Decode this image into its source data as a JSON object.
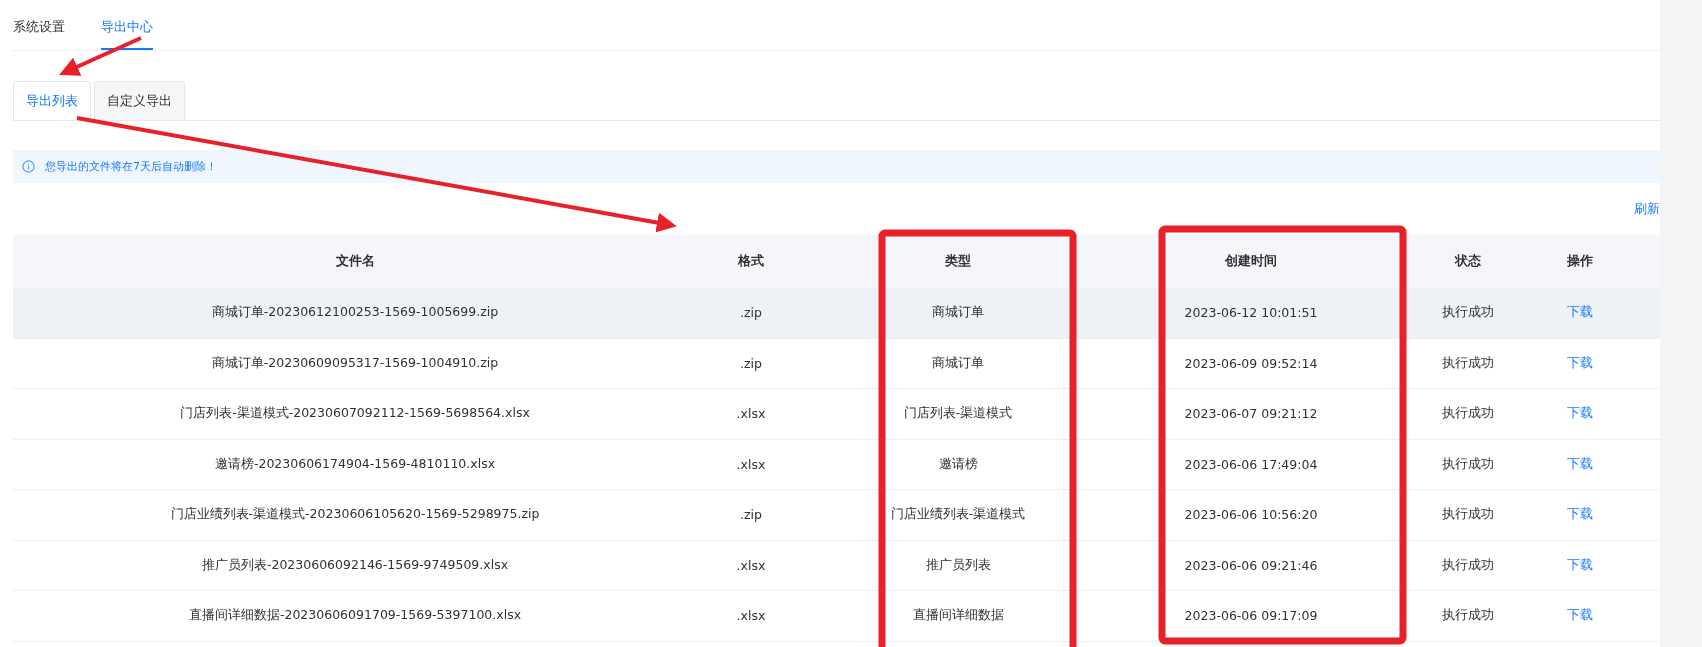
{
  "top_tabs": [
    {
      "label": "系统设置",
      "selected": false
    },
    {
      "label": "导出中心",
      "selected": true
    }
  ],
  "sub_tabs": [
    {
      "label": "导出列表",
      "selected": true
    },
    {
      "label": "自定义导出",
      "selected": false
    }
  ],
  "alert": {
    "text": "您导出的文件将在7天后自动删除！"
  },
  "refresh_link": "刷新",
  "table": {
    "columns": [
      "文件名",
      "格式",
      "类型",
      "创建时间",
      "状态",
      "操作"
    ],
    "rows": [
      {
        "file_name": "商城订单-20230612100253-1569-1005699.zip",
        "format": ".zip",
        "type": "商城订单",
        "created": "2023-06-12 10:01:51",
        "status": "执行成功",
        "action": "下载",
        "hovered": true
      },
      {
        "file_name": "商城订单-20230609095317-1569-1004910.zip",
        "format": ".zip",
        "type": "商城订单",
        "created": "2023-06-09 09:52:14",
        "status": "执行成功",
        "action": "下载",
        "hovered": false
      },
      {
        "file_name": "门店列表-渠道模式-20230607092112-1569-5698564.xlsx",
        "format": ".xlsx",
        "type": "门店列表-渠道模式",
        "created": "2023-06-07 09:21:12",
        "status": "执行成功",
        "action": "下载",
        "hovered": false
      },
      {
        "file_name": "邀请榜-20230606174904-1569-4810110.xlsx",
        "format": ".xlsx",
        "type": "邀请榜",
        "created": "2023-06-06 17:49:04",
        "status": "执行成功",
        "action": "下载",
        "hovered": false
      },
      {
        "file_name": "门店业绩列表-渠道模式-20230606105620-1569-5298975.zip",
        "format": ".zip",
        "type": "门店业绩列表-渠道模式",
        "created": "2023-06-06 10:56:20",
        "status": "执行成功",
        "action": "下载",
        "hovered": false
      },
      {
        "file_name": "推广员列表-20230606092146-1569-9749509.xlsx",
        "format": ".xlsx",
        "type": "推广员列表",
        "created": "2023-06-06 09:21:46",
        "status": "执行成功",
        "action": "下载",
        "hovered": false
      },
      {
        "file_name": "直播间详细数据-20230606091709-1569-5397100.xlsx",
        "format": ".xlsx",
        "type": "直播间详细数据",
        "created": "2023-06-06 09:17:09",
        "status": "执行成功",
        "action": "下载",
        "hovered": false
      }
    ]
  }
}
